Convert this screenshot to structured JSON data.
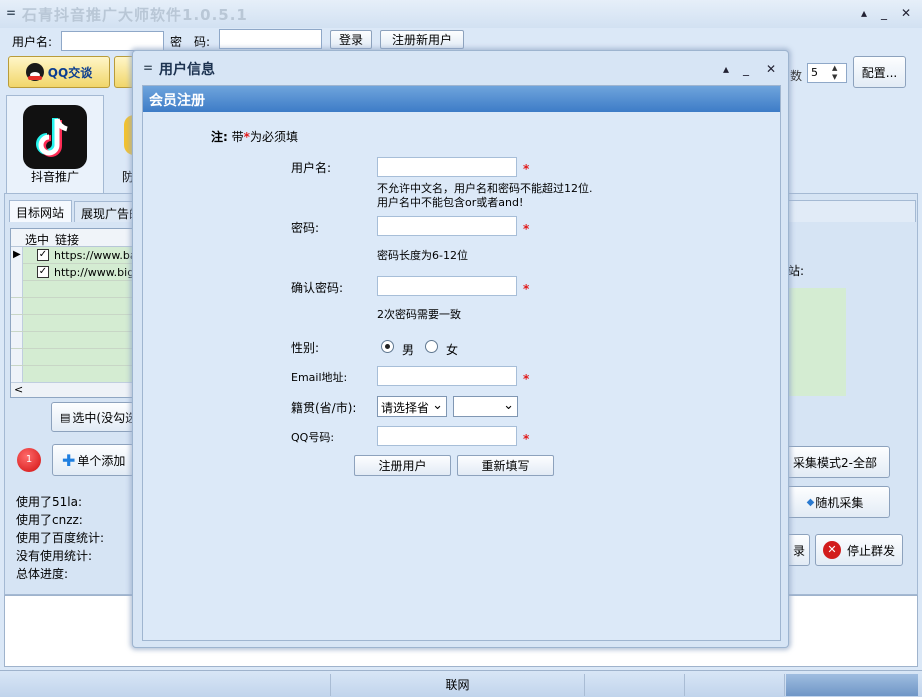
{
  "app": {
    "title": "石青抖音推广大师软件1.0.5.1",
    "sys_menu_glyph": "=",
    "min_glyph": "_",
    "max_glyph": "▴",
    "close_glyph": "✕"
  },
  "login": {
    "username_label": "用户名:",
    "password_label": "密　码:",
    "login_button": "登录",
    "register_button": "注册新用户"
  },
  "toolbar": {
    "qq_button": "QQ交谈",
    "spin_label": "数",
    "spin_value": "5",
    "config_button": "配置..."
  },
  "nav": {
    "douyin_label": "抖音推广",
    "second_label": "防"
  },
  "tabs": {
    "targets": "目标网站",
    "ads": "展现广告的"
  },
  "grid": {
    "col_selected": "选中",
    "col_link": "链接",
    "rows": [
      {
        "link": "https://www.bai"
      },
      {
        "link": "http://www.bigw"
      }
    ]
  },
  "left": {
    "select_button": "选中(没勾选",
    "badge": "1",
    "add_button": "单个添加",
    "stats": [
      "使用了51la:",
      "使用了cnzz:",
      "使用了百度统计:",
      "没有使用统计:",
      "总体进度:"
    ]
  },
  "right": {
    "site_label": "站:",
    "mode_button": "采集模式2-全部",
    "random_button": "随机采集",
    "partial_button": "录",
    "stop_button": "停止群发"
  },
  "dialog": {
    "title": "用户信息",
    "header": "会员注册",
    "note_prefix": "注:",
    "note_body": "带",
    "note_star": "*",
    "note_suffix": "为必须填",
    "username_label": "用户名:",
    "username_hint1": "不允许中文名，用户名和密码不能超过12位.",
    "username_hint2": "用户名中不能包含or或者and!",
    "password_label": "密码:",
    "password_hint": "密码长度为6-12位",
    "confirm_label": "确认密码:",
    "confirm_hint": "2次密码需要一致",
    "gender_label": "性别:",
    "male": "男",
    "female": "女",
    "email_label": "Email地址:",
    "origin_label": "籍贯(省/市):",
    "province_select": "请选择省",
    "qq_label": "QQ号码:",
    "star": "*",
    "submit_button": "注册用户",
    "reset_button": "重新填写",
    "min_glyph": "_",
    "max_glyph": "▴",
    "close_glyph": "✕"
  },
  "status": {
    "network": "联网"
  }
}
